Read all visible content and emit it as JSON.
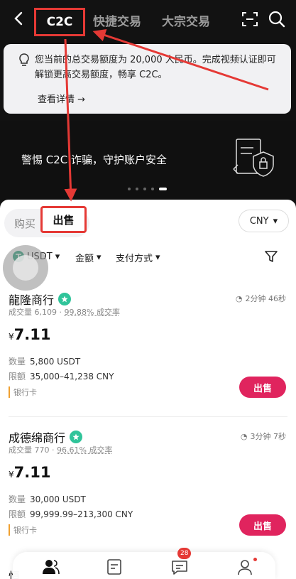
{
  "header": {
    "tabs": [
      "C2C",
      "快捷交易",
      "大宗交易"
    ]
  },
  "notice": {
    "text": "您当前的总交易额度为 20,000 人民币。完成视频认证即可解锁更高交易额度，畅享 C2C。",
    "link": "查看详情 →"
  },
  "banner": {
    "text": "警惕 C2C 诈骗，守护账户安全"
  },
  "segment": {
    "buy": "购买",
    "sell": "出售"
  },
  "currency": "CNY",
  "filters": {
    "coin": "USDT",
    "amount": "金额",
    "payment": "支付方式"
  },
  "merchants": [
    {
      "name": "龍隆商行",
      "time": "2分钟 46秒",
      "volume": "成交量 6,109",
      "rate": "99.88% 成交率",
      "currency_symbol": "¥",
      "price": "7.11",
      "quantity_label": "数量",
      "quantity": "5,800 USDT",
      "limit_label": "限额",
      "limit": "35,000–41,238 CNY",
      "payment": "银行卡",
      "action": "出售"
    },
    {
      "name": "成德绵商行",
      "time": "3分钟 7秒",
      "volume": "成交量 770",
      "rate": "96.61% 成交率",
      "currency_symbol": "¥",
      "price": "7.11",
      "quantity_label": "数量",
      "quantity": "30,000 USDT",
      "limit_label": "限额",
      "limit": "99,999.99–213,300 CNY",
      "payment": "银行卡",
      "action": "出售"
    }
  ],
  "partial_name": "恒",
  "bottom_nav": {
    "messages_badge": "28"
  },
  "colors": {
    "accent": "#e0245e",
    "annotation": "#e53935",
    "tether": "#26a17b"
  }
}
